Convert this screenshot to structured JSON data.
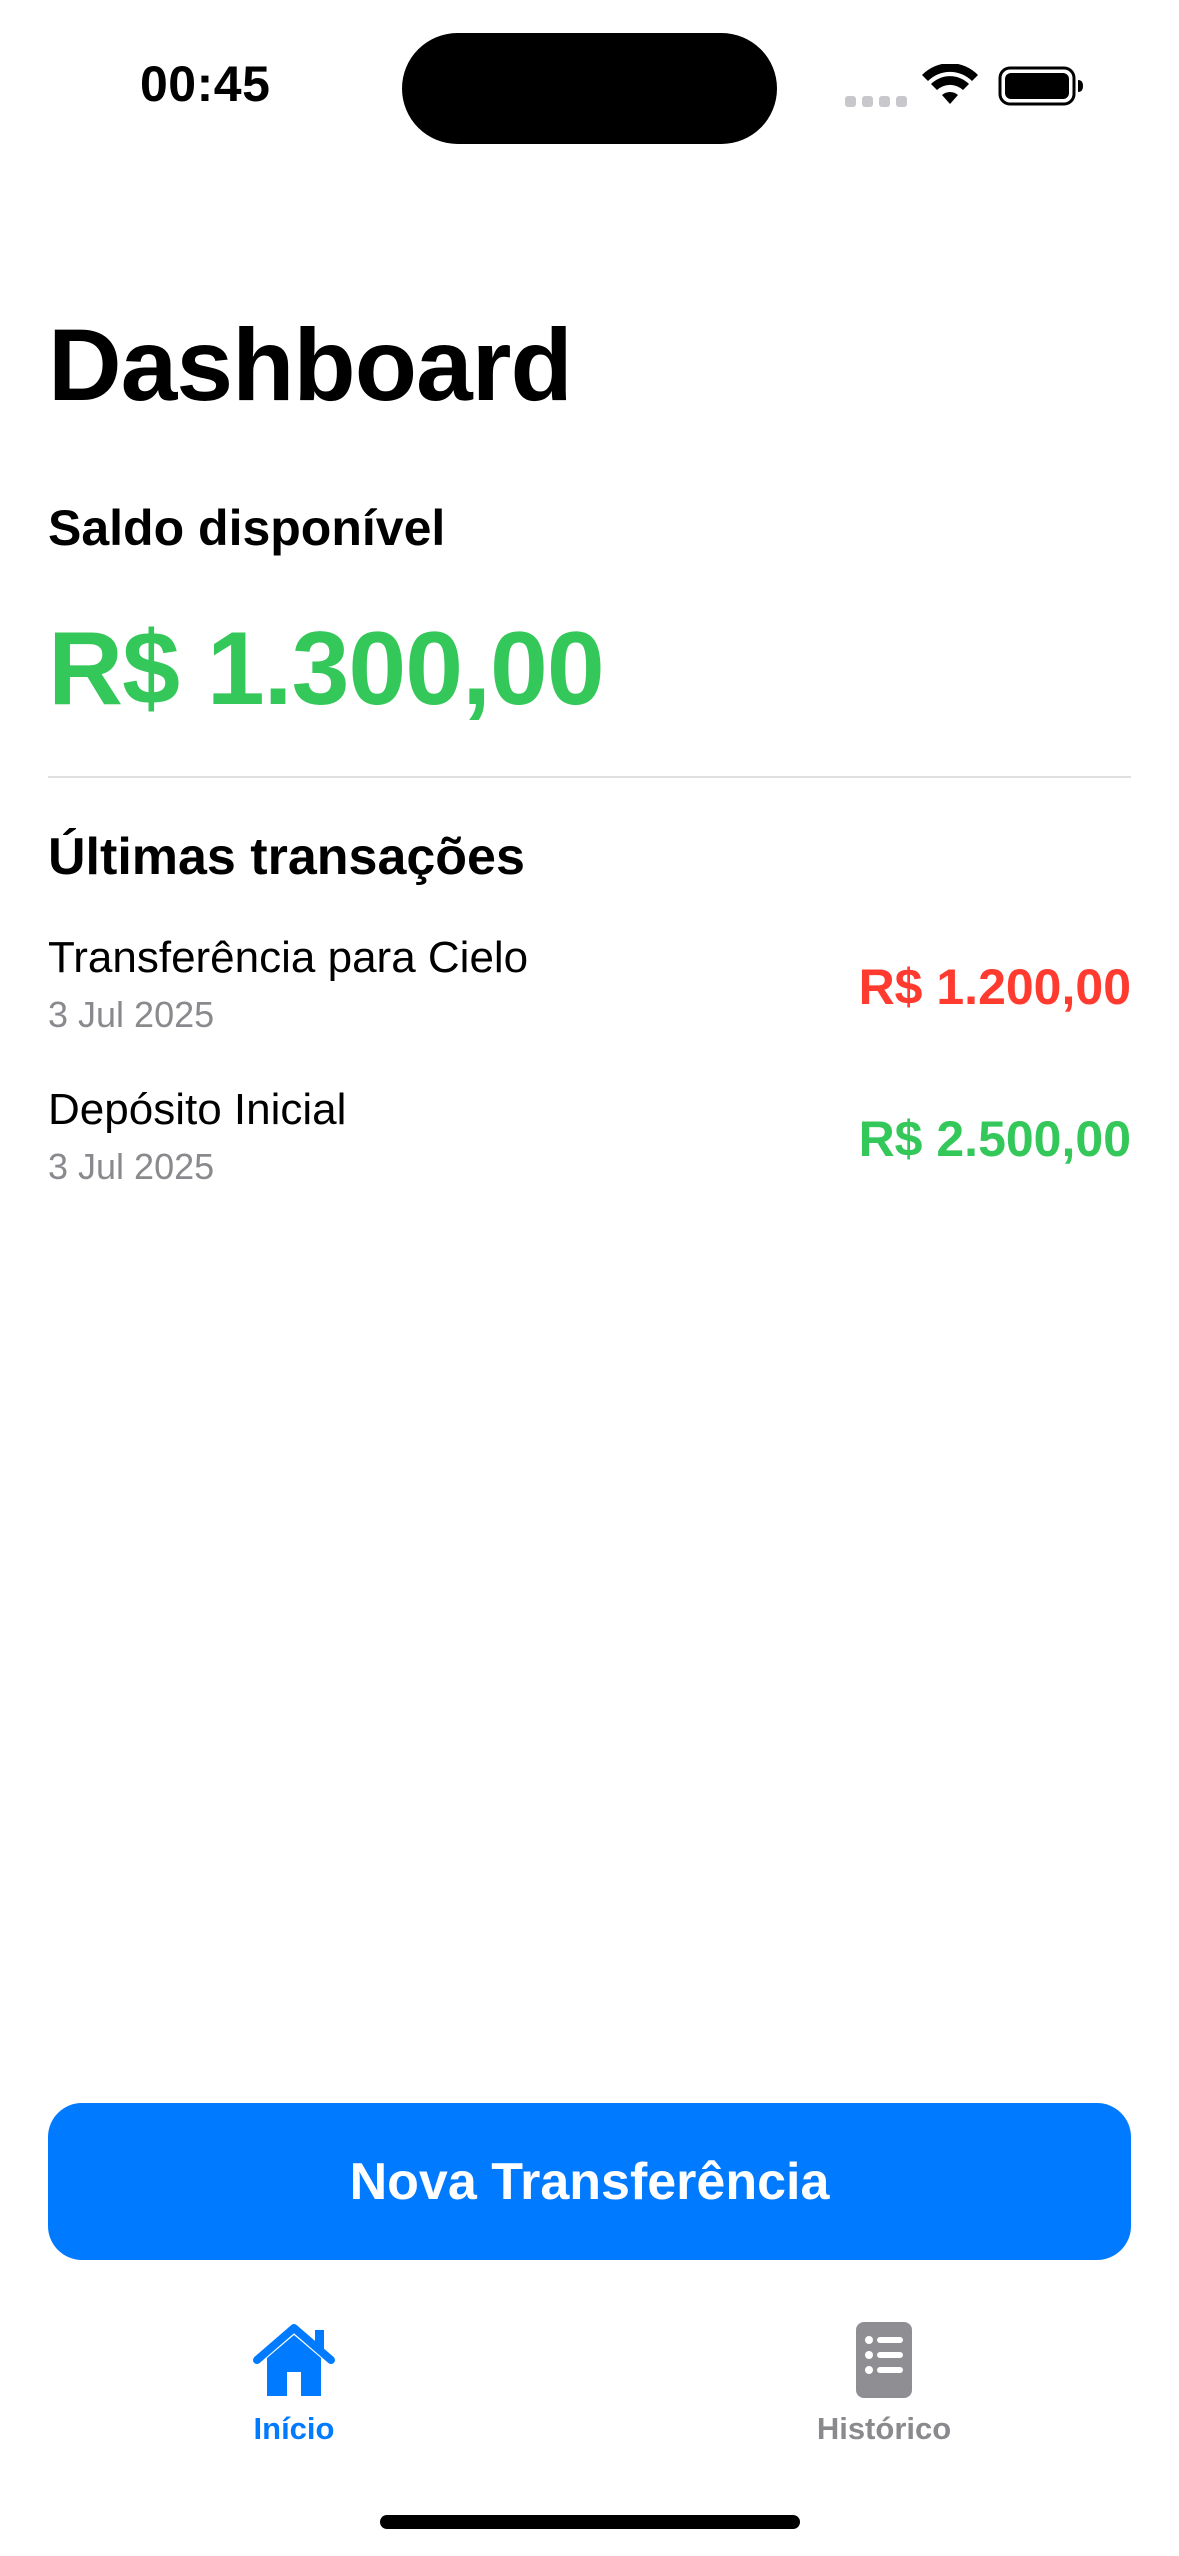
{
  "status_bar": {
    "time": "00:45",
    "wifi_icon": "wifi-icon",
    "battery_icon": "battery-icon"
  },
  "page": {
    "title": "Dashboard"
  },
  "balance": {
    "label": "Saldo disponível",
    "value": "R$ 1.300,00",
    "color": "#34c759"
  },
  "transactions": {
    "title": "Últimas transações",
    "items": [
      {
        "description": "Transferência para Cielo",
        "date": "3 Jul 2025",
        "amount": "R$ 1.200,00",
        "color": "#ff3b30"
      },
      {
        "description": "Depósito Inicial",
        "date": "3 Jul 2025",
        "amount": "R$ 2.500,00",
        "color": "#34c759"
      }
    ]
  },
  "actions": {
    "new_transfer_label": "Nova Transferência",
    "accent": "#007aff"
  },
  "tab_bar": {
    "items": [
      {
        "label": "Início",
        "icon": "house-icon",
        "selected": true
      },
      {
        "label": "Histórico",
        "icon": "list-icon",
        "selected": false
      }
    ]
  }
}
